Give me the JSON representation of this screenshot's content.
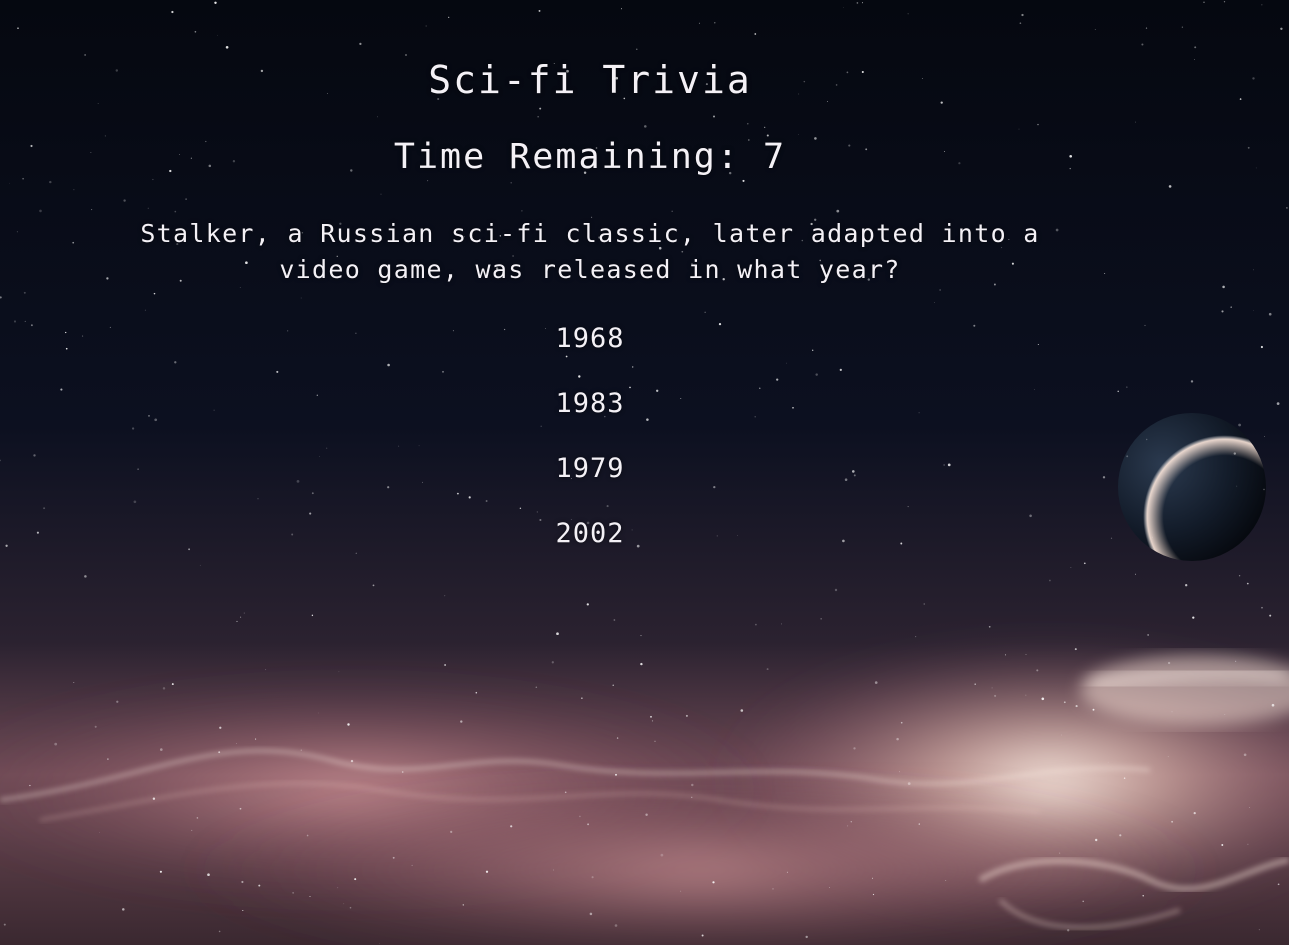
{
  "header": {
    "title": "Sci-fi Trivia",
    "timer_label": "Time Remaining: 7"
  },
  "question": {
    "text": "Stalker, a Russian sci-fi classic, later adapted into a video game, was released in what year?"
  },
  "answers": [
    {
      "label": "1968"
    },
    {
      "label": "1983"
    },
    {
      "label": "1979"
    },
    {
      "label": "2002"
    }
  ],
  "colors": {
    "text": "#f4f1f6",
    "space": "#070a12",
    "nebula_glow": "#f3d2c8"
  }
}
